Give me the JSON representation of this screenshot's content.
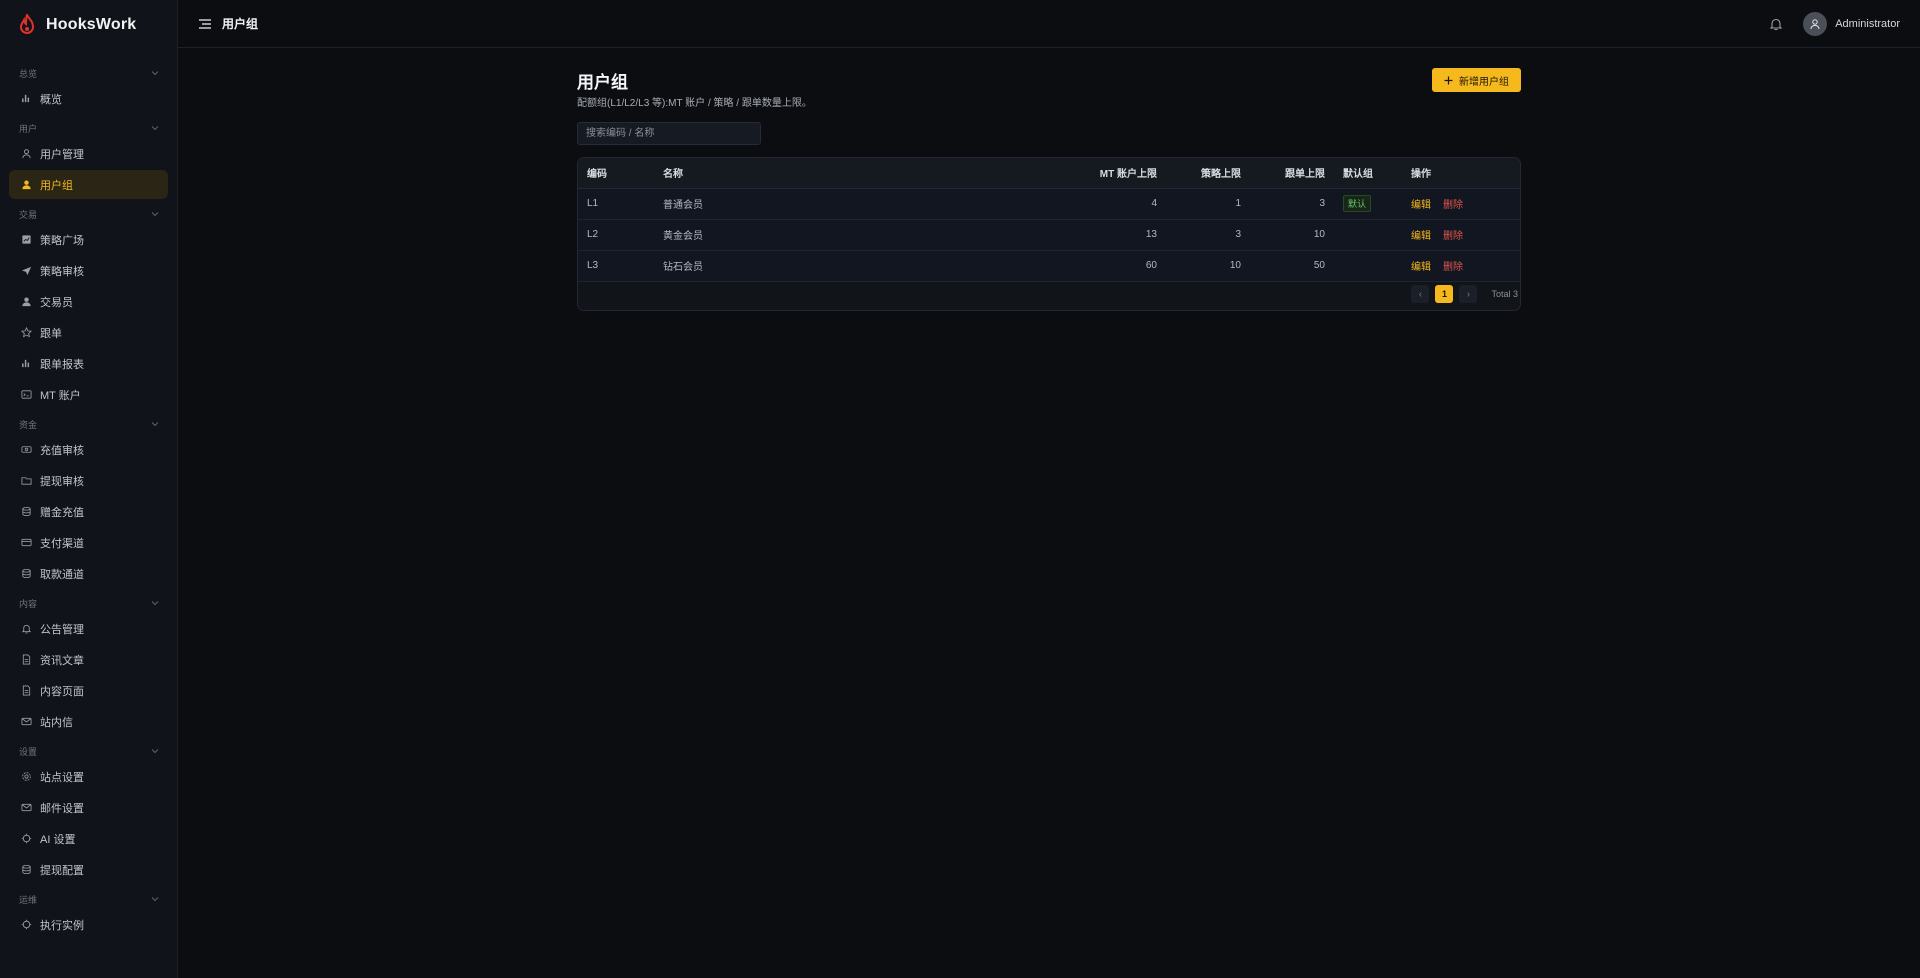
{
  "brand": {
    "name": "HooksWork"
  },
  "topbar": {
    "title": "用户组",
    "user": "Administrator"
  },
  "sidebar": {
    "groups": [
      {
        "title": "总览",
        "items": [
          {
            "label": "概览",
            "icon": "bar-chart-icon"
          }
        ]
      },
      {
        "title": "用户",
        "items": [
          {
            "label": "用户管理",
            "icon": "user-outline-icon"
          },
          {
            "label": "用户组",
            "icon": "user-icon",
            "active": true
          }
        ]
      },
      {
        "title": "交易",
        "items": [
          {
            "label": "策略广场",
            "icon": "chart-box-icon"
          },
          {
            "label": "策略审核",
            "icon": "send-icon"
          },
          {
            "label": "交易员",
            "icon": "user-icon"
          },
          {
            "label": "跟单",
            "icon": "star-icon"
          },
          {
            "label": "跟单报表",
            "icon": "bar-chart-icon"
          },
          {
            "label": "MT 账户",
            "icon": "terminal-icon"
          }
        ]
      },
      {
        "title": "资金",
        "items": [
          {
            "label": "充值审核",
            "icon": "cash-icon"
          },
          {
            "label": "提现审核",
            "icon": "folder-icon"
          },
          {
            "label": "赠金充值",
            "icon": "database-icon"
          },
          {
            "label": "支付渠道",
            "icon": "card-icon"
          },
          {
            "label": "取款通道",
            "icon": "database-icon"
          }
        ]
      },
      {
        "title": "内容",
        "items": [
          {
            "label": "公告管理",
            "icon": "bell-icon"
          },
          {
            "label": "资讯文章",
            "icon": "document-icon"
          },
          {
            "label": "内容页面",
            "icon": "document-icon"
          },
          {
            "label": "站内信",
            "icon": "mail-icon"
          }
        ]
      },
      {
        "title": "设置",
        "items": [
          {
            "label": "站点设置",
            "icon": "gear-icon"
          },
          {
            "label": "邮件设置",
            "icon": "mail-icon"
          },
          {
            "label": "AI 设置",
            "icon": "chip-icon"
          },
          {
            "label": "提现配置",
            "icon": "database-icon"
          }
        ]
      },
      {
        "title": "运维",
        "items": [
          {
            "label": "执行实例",
            "icon": "chip-icon"
          }
        ]
      }
    ]
  },
  "main": {
    "title": "用户组",
    "description": "配额组(L1/L2/L3 等):MT 账户 / 策略 / 跟单数量上限。",
    "add_button": "新增用户组",
    "search_placeholder": "搜索编码 / 名称",
    "table": {
      "columns": [
        "编码",
        "名称",
        "MT 账户上限",
        "策略上限",
        "跟单上限",
        "默认组",
        "操作"
      ],
      "rows": [
        {
          "code": "L1",
          "name": "普通会员",
          "mt": "4",
          "strategy": "1",
          "follow": "3",
          "default": "默认"
        },
        {
          "code": "L2",
          "name": "黄金会员",
          "mt": "13",
          "strategy": "3",
          "follow": "10",
          "default": ""
        },
        {
          "code": "L3",
          "name": "钻石会员",
          "mt": "60",
          "strategy": "10",
          "follow": "50",
          "default": ""
        }
      ],
      "edit_label": "编辑",
      "delete_label": "删除"
    },
    "pagination": {
      "current": "1",
      "total_text": "Total 3",
      "prev": "‹",
      "next": "›"
    }
  },
  "colors": {
    "accent": "#f5b91e",
    "danger": "#e0564f",
    "success": "#6ac46a",
    "background": "#0b0d11"
  }
}
